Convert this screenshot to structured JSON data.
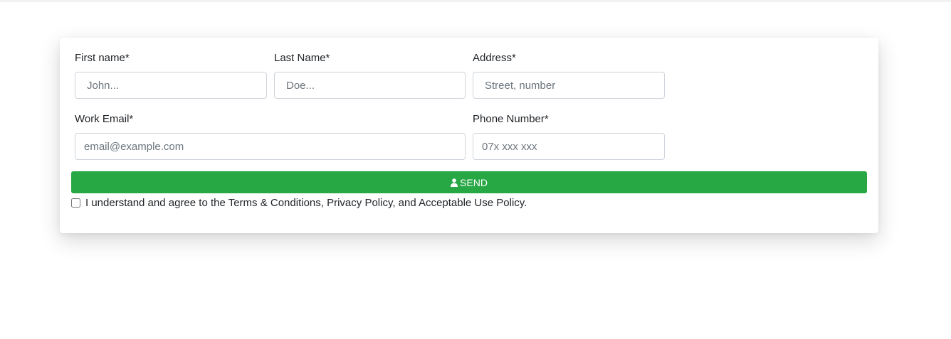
{
  "form": {
    "first_name": {
      "label": "First name*",
      "placeholder": "John..."
    },
    "last_name": {
      "label": "Last Name*",
      "placeholder": "Doe..."
    },
    "address": {
      "label": "Address*",
      "placeholder": "Street, number"
    },
    "work_email": {
      "label": "Work Email*",
      "placeholder": "email@example.com"
    },
    "phone": {
      "label": "Phone Number*",
      "placeholder": "07x xxx xxx"
    },
    "send_button": {
      "label": "SEND",
      "icon": "user-icon"
    },
    "agree": {
      "text": "I understand and agree to the Terms & Conditions, Privacy Policy, and Acceptable Use Policy.",
      "checked": false
    },
    "colors": {
      "send_button_bg": "#28a745",
      "input_border": "#ced4da",
      "placeholder": "#6c757d"
    }
  }
}
